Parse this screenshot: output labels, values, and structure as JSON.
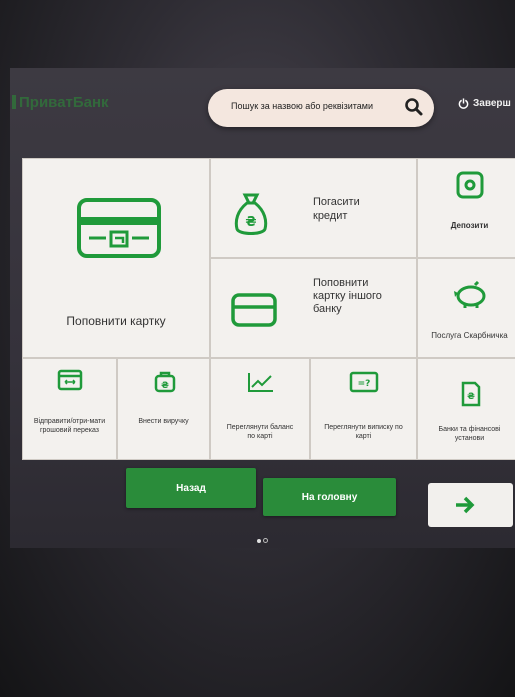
{
  "brand": {
    "logo_text": "ПриватБанк"
  },
  "header": {
    "search_placeholder": "Пошук за назвою або реквізитами",
    "exit_label": "Заверш"
  },
  "tiles": {
    "topup_card": "Поповнити картку",
    "repay_credit": "Погасити кредит",
    "deposits": "Депозити",
    "topup_other_bank": "Поповнити картку іншого банку",
    "piggy": "Послуга Скарбничка",
    "transfer": "Відправити/отри-мати грошовий переказ",
    "revenue": "Внести виручку",
    "balance": "Переглянути баланс по карті",
    "statement": "Переглянути виписку по карті",
    "banks": "Банки та фінансові установи"
  },
  "nav": {
    "back_label": "Назад",
    "home_label": "На головну",
    "next_icon": "arrow-right-icon"
  },
  "pager": {
    "pages": 2,
    "current": 1
  },
  "colors": {
    "accent": "#2a8c3a",
    "icon_green": "#1f9a3a",
    "tile_bg": "#f3f1ee"
  }
}
